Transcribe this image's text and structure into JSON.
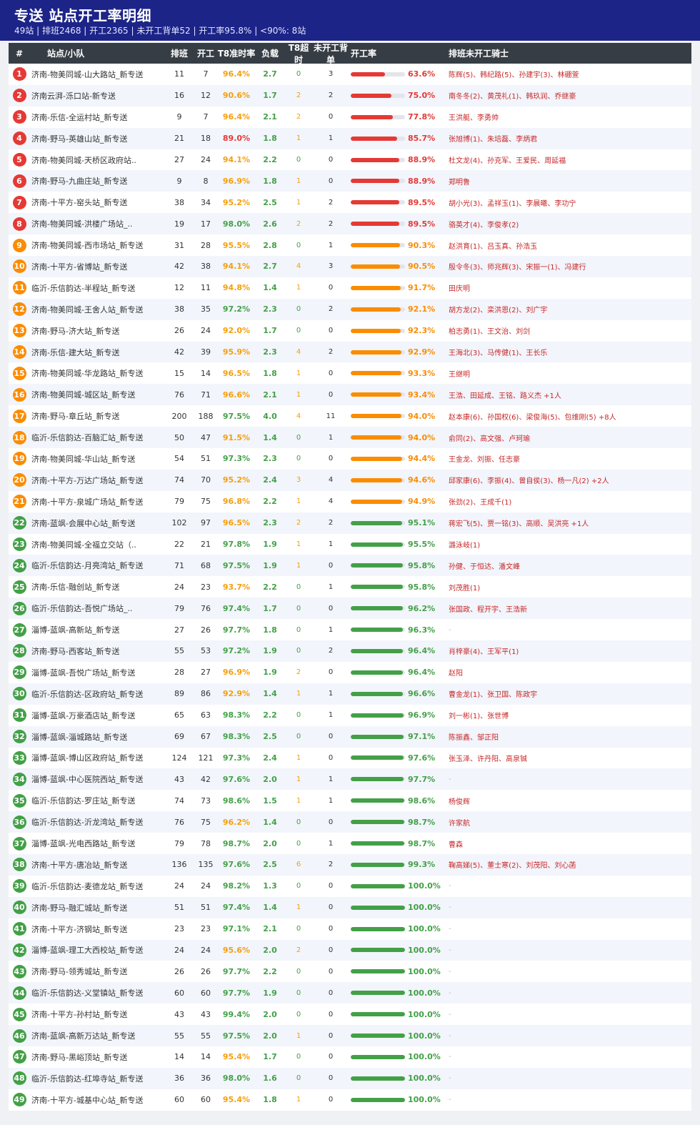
{
  "header": {
    "title": "专送  站点开工率明细",
    "summary": "49站 | 排班2468 | 开工2365 | 未开工背单52 | 开工率95.8% | <90%: 8站"
  },
  "columns": [
    "#",
    "站点/小队",
    "排班",
    "开工",
    "T8准时率",
    "负载",
    "T8超时",
    "未开工背单",
    "开工率",
    "排班未开工骑士"
  ],
  "colors": {
    "red": "#e53935",
    "orange": "#fb8c00",
    "green": "#43a047",
    "t8_orange": "#f59e0b",
    "t8_red": "#e53935"
  },
  "rows": [
    {
      "idx": "1",
      "name": "济南-物美同城-山大路站_新专送",
      "sched": "11",
      "start": "7",
      "t8": "96.4%",
      "load": "2.7",
      "t8o": "0",
      "unstart": "3",
      "rate": "63.6%",
      "riders": "陈辉(5)、韩纪路(5)、孙建宇(3)、林硼萱"
    },
    {
      "idx": "2",
      "name": "济南云湃-泺口站-新专送",
      "sched": "16",
      "start": "12",
      "t8": "90.6%",
      "load": "1.7",
      "t8o": "2",
      "unstart": "2",
      "rate": "75.0%",
      "riders": "南冬冬(2)、黄茂礼(1)、韩玖润、乔继豪"
    },
    {
      "idx": "3",
      "name": "济南-乐信-全运村站_新专送",
      "sched": "9",
      "start": "7",
      "t8": "96.4%",
      "load": "2.1",
      "t8o": "2",
      "unstart": "0",
      "rate": "77.8%",
      "riders": "王洪艇、李勇帅"
    },
    {
      "idx": "4",
      "name": "济南-野马-英雄山站_新专送",
      "sched": "21",
      "start": "18",
      "t8": "89.0%",
      "load": "1.8",
      "t8o": "1",
      "unstart": "1",
      "rate": "85.7%",
      "riders": "张旭博(1)、朱培磊、李炳君"
    },
    {
      "idx": "5",
      "name": "济南-物美同城-天桥区政府站..",
      "sched": "27",
      "start": "24",
      "t8": "94.1%",
      "load": "2.2",
      "t8o": "0",
      "unstart": "0",
      "rate": "88.9%",
      "riders": "杜文龙(4)、孙克军、王爱民、周延福"
    },
    {
      "idx": "6",
      "name": "济南-野马-九曲庄站_新专送",
      "sched": "9",
      "start": "8",
      "t8": "96.9%",
      "load": "1.8",
      "t8o": "1",
      "unstart": "0",
      "rate": "88.9%",
      "riders": "郑明鲁"
    },
    {
      "idx": "7",
      "name": "济南-十平方-窑头站_新专送",
      "sched": "38",
      "start": "34",
      "t8": "95.2%",
      "load": "2.5",
      "t8o": "1",
      "unstart": "2",
      "rate": "89.5%",
      "riders": "胡小光(3)、孟祥玉(1)、李晨曦、李功宁"
    },
    {
      "idx": "8",
      "name": "济南-物美同城-洪楼广场站_..",
      "sched": "19",
      "start": "17",
      "t8": "98.0%",
      "load": "2.6",
      "t8o": "2",
      "unstart": "2",
      "rate": "89.5%",
      "riders": "骆英才(4)、李俊孝(2)"
    },
    {
      "idx": "9",
      "name": "济南-物美同城-西市场站_新专送",
      "sched": "31",
      "start": "28",
      "t8": "95.5%",
      "load": "2.8",
      "t8o": "0",
      "unstart": "1",
      "rate": "90.3%",
      "riders": "赵洪育(1)、吕玉真、孙浩玉"
    },
    {
      "idx": "10",
      "name": "济南-十平方-省博站_新专送",
      "sched": "42",
      "start": "38",
      "t8": "94.1%",
      "load": "2.7",
      "t8o": "4",
      "unstart": "3",
      "rate": "90.5%",
      "riders": "殷令冬(3)、师兆辉(3)、宋振一(1)、冯建行"
    },
    {
      "idx": "11",
      "name": "临沂-乐信韵达-半程站_新专送",
      "sched": "12",
      "start": "11",
      "t8": "94.8%",
      "load": "1.4",
      "t8o": "1",
      "unstart": "0",
      "rate": "91.7%",
      "riders": "田庆明"
    },
    {
      "idx": "12",
      "name": "济南-物美同城-王舍人站_新专送",
      "sched": "38",
      "start": "35",
      "t8": "97.2%",
      "load": "2.3",
      "t8o": "0",
      "unstart": "2",
      "rate": "92.1%",
      "riders": "胡方龙(2)、栾洪恩(2)、刘广宇"
    },
    {
      "idx": "13",
      "name": "济南-野马-济大站_新专送",
      "sched": "26",
      "start": "24",
      "t8": "92.0%",
      "load": "1.7",
      "t8o": "0",
      "unstart": "0",
      "rate": "92.3%",
      "riders": "柏志勇(1)、王文治、刘剑"
    },
    {
      "idx": "14",
      "name": "济南-乐信-建大站_新专送",
      "sched": "42",
      "start": "39",
      "t8": "95.9%",
      "load": "2.3",
      "t8o": "4",
      "unstart": "2",
      "rate": "92.9%",
      "riders": "王海北(3)、马传健(1)、王长乐"
    },
    {
      "idx": "15",
      "name": "济南-物美同城-华龙路站_新专送",
      "sched": "15",
      "start": "14",
      "t8": "96.5%",
      "load": "1.8",
      "t8o": "1",
      "unstart": "0",
      "rate": "93.3%",
      "riders": "王继明"
    },
    {
      "idx": "16",
      "name": "济南-物美同城-城区站_新专送",
      "sched": "76",
      "start": "71",
      "t8": "96.6%",
      "load": "2.1",
      "t8o": "1",
      "unstart": "0",
      "rate": "93.4%",
      "riders": "王浩、田延成、王铭、路义杰 +1人"
    },
    {
      "idx": "17",
      "name": "济南-野马-章丘站_新专送",
      "sched": "200",
      "start": "188",
      "t8": "97.5%",
      "load": "4.0",
      "t8o": "4",
      "unstart": "11",
      "rate": "94.0%",
      "riders": "赵本康(6)、孙国权(6)、梁俊海(5)、包维刚(5) +8人"
    },
    {
      "idx": "18",
      "name": "临沂-乐信韵达-百脑汇站_新专送",
      "sched": "50",
      "start": "47",
      "t8": "91.5%",
      "load": "1.4",
      "t8o": "0",
      "unstart": "1",
      "rate": "94.0%",
      "riders": "俞同(2)、高文强、卢珂瑜"
    },
    {
      "idx": "19",
      "name": "济南-物美同城-华山站_新专送",
      "sched": "54",
      "start": "51",
      "t8": "97.3%",
      "load": "2.3",
      "t8o": "0",
      "unstart": "0",
      "rate": "94.4%",
      "riders": "王金龙、刘振、任志豪"
    },
    {
      "idx": "20",
      "name": "济南-十平方-万达广场站_新专送",
      "sched": "74",
      "start": "70",
      "t8": "95.2%",
      "load": "2.4",
      "t8o": "3",
      "unstart": "4",
      "rate": "94.6%",
      "riders": "邱家康(6)、李振(4)、曾自侯(3)、杨一凡(2) +2人"
    },
    {
      "idx": "21",
      "name": "济南-十平方-泉城广场站_新专送",
      "sched": "79",
      "start": "75",
      "t8": "96.8%",
      "load": "2.2",
      "t8o": "1",
      "unstart": "4",
      "rate": "94.9%",
      "riders": "张劲(2)、王成千(1)"
    },
    {
      "idx": "22",
      "name": "济南-蓝飒-会展中心站_新专送",
      "sched": "102",
      "start": "97",
      "t8": "96.5%",
      "load": "2.3",
      "t8o": "2",
      "unstart": "2",
      "rate": "95.1%",
      "riders": "蒋宏飞(5)、贾一铭(3)、高顺、吴洪亮 +1人"
    },
    {
      "idx": "23",
      "name": "济南-物美同城-全福立交站（..",
      "sched": "22",
      "start": "21",
      "t8": "97.8%",
      "load": "1.9",
      "t8o": "1",
      "unstart": "1",
      "rate": "95.5%",
      "riders": "潞泳岐(1)"
    },
    {
      "idx": "24",
      "name": "临沂-乐信韵达-月亮湾站_新专送",
      "sched": "71",
      "start": "68",
      "t8": "97.5%",
      "load": "1.9",
      "t8o": "1",
      "unstart": "0",
      "rate": "95.8%",
      "riders": "孙健、于恒达、潘文峰"
    },
    {
      "idx": "25",
      "name": "济南-乐信-融创站_新专送",
      "sched": "24",
      "start": "23",
      "t8": "93.7%",
      "load": "2.2",
      "t8o": "0",
      "unstart": "1",
      "rate": "95.8%",
      "riders": "刘茂胜(1)"
    },
    {
      "idx": "26",
      "name": "临沂-乐信韵达-吾悦广场站_..",
      "sched": "79",
      "start": "76",
      "t8": "97.4%",
      "load": "1.7",
      "t8o": "0",
      "unstart": "0",
      "rate": "96.2%",
      "riders": "张国政、程开宇、王浩新"
    },
    {
      "idx": "27",
      "name": "淄博-蓝飒-高新站_新专送",
      "sched": "27",
      "start": "26",
      "t8": "97.7%",
      "load": "1.8",
      "t8o": "0",
      "unstart": "1",
      "rate": "96.3%",
      "riders": "-"
    },
    {
      "idx": "28",
      "name": "济南-野马-西客站_新专送",
      "sched": "55",
      "start": "53",
      "t8": "97.2%",
      "load": "1.9",
      "t8o": "0",
      "unstart": "2",
      "rate": "96.4%",
      "riders": "肖梓豪(4)、王军平(1)"
    },
    {
      "idx": "29",
      "name": "淄博-蓝飒-吾悦广场站_新专送",
      "sched": "28",
      "start": "27",
      "t8": "96.9%",
      "load": "1.9",
      "t8o": "2",
      "unstart": "0",
      "rate": "96.4%",
      "riders": "赵阳"
    },
    {
      "idx": "30",
      "name": "临沂-乐信韵达-区政府站_新专送",
      "sched": "89",
      "start": "86",
      "t8": "92.9%",
      "load": "1.4",
      "t8o": "1",
      "unstart": "1",
      "rate": "96.6%",
      "riders": "曹金龙(1)、张卫国、陈政宇"
    },
    {
      "idx": "31",
      "name": "淄博-蓝飒-万豪酒店站_新专送",
      "sched": "65",
      "start": "63",
      "t8": "98.3%",
      "load": "2.2",
      "t8o": "0",
      "unstart": "1",
      "rate": "96.9%",
      "riders": "刘一彬(1)、张世博"
    },
    {
      "idx": "32",
      "name": "淄博-蓝飒-淄城路站_新专送",
      "sched": "69",
      "start": "67",
      "t8": "98.3%",
      "load": "2.5",
      "t8o": "0",
      "unstart": "0",
      "rate": "97.1%",
      "riders": "陈振鑫、邹正阳"
    },
    {
      "idx": "33",
      "name": "淄博-蓝飒-博山区政府站_新专送",
      "sched": "124",
      "start": "121",
      "t8": "97.3%",
      "load": "2.4",
      "t8o": "1",
      "unstart": "0",
      "rate": "97.6%",
      "riders": "张玉泽、许丹阳、高泉铖"
    },
    {
      "idx": "34",
      "name": "淄博-蓝飒-中心医院西站_新专送",
      "sched": "43",
      "start": "42",
      "t8": "97.6%",
      "load": "2.0",
      "t8o": "1",
      "unstart": "1",
      "rate": "97.7%",
      "riders": "-"
    },
    {
      "idx": "35",
      "name": "临沂-乐信韵达-罗庄站_新专送",
      "sched": "74",
      "start": "73",
      "t8": "98.6%",
      "load": "1.5",
      "t8o": "1",
      "unstart": "1",
      "rate": "98.6%",
      "riders": "杨俊辉"
    },
    {
      "idx": "36",
      "name": "临沂-乐信韵达-沂龙湾站_新专送",
      "sched": "76",
      "start": "75",
      "t8": "96.2%",
      "load": "1.4",
      "t8o": "0",
      "unstart": "0",
      "rate": "98.7%",
      "riders": "许家航"
    },
    {
      "idx": "37",
      "name": "淄博-蓝飒-光电西路站_新专送",
      "sched": "79",
      "start": "78",
      "t8": "98.7%",
      "load": "2.0",
      "t8o": "0",
      "unstart": "1",
      "rate": "98.7%",
      "riders": "曹森"
    },
    {
      "idx": "38",
      "name": "济南-十平方-唐冶站_新专送",
      "sched": "136",
      "start": "135",
      "t8": "97.6%",
      "load": "2.5",
      "t8o": "6",
      "unstart": "2",
      "rate": "99.3%",
      "riders": "鞠高娣(5)、董士寒(2)、刘茂阳、刘心菡"
    },
    {
      "idx": "39",
      "name": "临沂-乐信韵达-麦德龙站_新专送",
      "sched": "24",
      "start": "24",
      "t8": "98.2%",
      "load": "1.3",
      "t8o": "0",
      "unstart": "0",
      "rate": "100.0%",
      "riders": "-"
    },
    {
      "idx": "40",
      "name": "济南-野马-融汇城站_新专送",
      "sched": "51",
      "start": "51",
      "t8": "97.4%",
      "load": "1.4",
      "t8o": "1",
      "unstart": "0",
      "rate": "100.0%",
      "riders": "-"
    },
    {
      "idx": "41",
      "name": "济南-十平方-济钢站_新专送",
      "sched": "23",
      "start": "23",
      "t8": "97.1%",
      "load": "2.1",
      "t8o": "0",
      "unstart": "0",
      "rate": "100.0%",
      "riders": "-"
    },
    {
      "idx": "42",
      "name": "淄博-蓝飒-理工大西校站_新专送",
      "sched": "24",
      "start": "24",
      "t8": "95.6%",
      "load": "2.0",
      "t8o": "2",
      "unstart": "0",
      "rate": "100.0%",
      "riders": "-"
    },
    {
      "idx": "43",
      "name": "济南-野马-领秀城站_新专送",
      "sched": "26",
      "start": "26",
      "t8": "97.7%",
      "load": "2.2",
      "t8o": "0",
      "unstart": "0",
      "rate": "100.0%",
      "riders": "-"
    },
    {
      "idx": "44",
      "name": "临沂-乐信韵达-义堂镇站_新专送",
      "sched": "60",
      "start": "60",
      "t8": "97.7%",
      "load": "1.9",
      "t8o": "0",
      "unstart": "0",
      "rate": "100.0%",
      "riders": "-"
    },
    {
      "idx": "45",
      "name": "济南-十平方-孙村站_新专送",
      "sched": "43",
      "start": "43",
      "t8": "99.4%",
      "load": "2.0",
      "t8o": "0",
      "unstart": "0",
      "rate": "100.0%",
      "riders": "-"
    },
    {
      "idx": "46",
      "name": "济南-蓝飒-高新万达站_新专送",
      "sched": "55",
      "start": "55",
      "t8": "97.5%",
      "load": "2.0",
      "t8o": "1",
      "unstart": "0",
      "rate": "100.0%",
      "riders": "-"
    },
    {
      "idx": "47",
      "name": "济南-野马-黑峪顶站_新专送",
      "sched": "14",
      "start": "14",
      "t8": "95.4%",
      "load": "1.7",
      "t8o": "0",
      "unstart": "0",
      "rate": "100.0%",
      "riders": "-"
    },
    {
      "idx": "48",
      "name": "临沂-乐信韵达-红埠寺站_新专送",
      "sched": "36",
      "start": "36",
      "t8": "98.0%",
      "load": "1.6",
      "t8o": "0",
      "unstart": "0",
      "rate": "100.0%",
      "riders": "-"
    },
    {
      "idx": "49",
      "name": "济南-十平方-城基中心站_新专送",
      "sched": "60",
      "start": "60",
      "t8": "95.4%",
      "load": "1.8",
      "t8o": "1",
      "unstart": "0",
      "rate": "100.0%",
      "riders": "-"
    }
  ]
}
